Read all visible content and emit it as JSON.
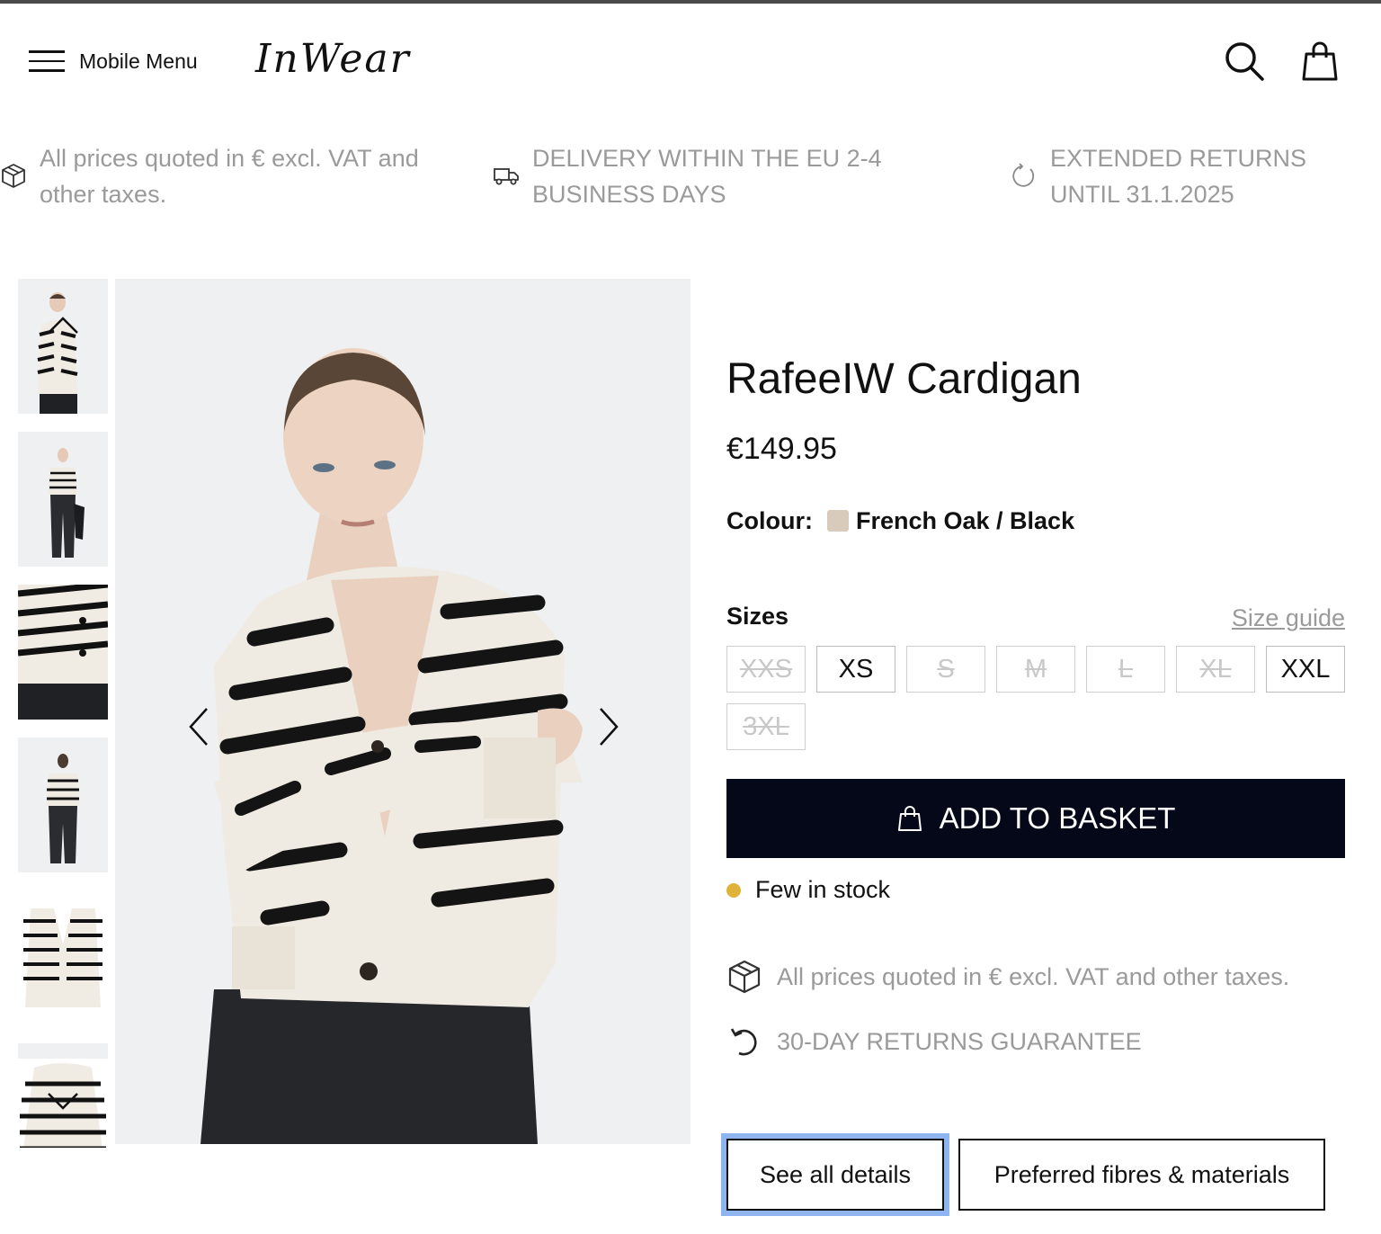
{
  "header": {
    "menu_label": "Mobile Menu",
    "logo": "InWear",
    "icons": [
      "hamburger-icon",
      "search-icon",
      "bag-icon"
    ]
  },
  "usp": [
    {
      "icon": "box-icon",
      "text": "All prices quoted in € excl. VAT and other taxes."
    },
    {
      "icon": "truck-icon",
      "text": "DELIVERY WITHIN THE EU 2-4 BUSINESS DAYS"
    },
    {
      "icon": "refresh-icon",
      "text": "EXTENDED RETURNS UNTIL 31.1.2025"
    }
  ],
  "product": {
    "title": "RafeeIW Cardigan",
    "price": "€149.95",
    "colour_label": "Colour:",
    "colour_name": "French Oak / Black",
    "colour_hex": "#d8cbbb",
    "sizes_label": "Sizes",
    "size_guide": "Size guide",
    "sizes": [
      {
        "label": "XXS",
        "available": false
      },
      {
        "label": "XS",
        "available": true
      },
      {
        "label": "S",
        "available": false
      },
      {
        "label": "M",
        "available": false
      },
      {
        "label": "L",
        "available": false
      },
      {
        "label": "XL",
        "available": false
      },
      {
        "label": "XXL",
        "available": true
      },
      {
        "label": "3XL",
        "available": false
      }
    ],
    "add_to_basket": "ADD TO BASKET",
    "stock": "Few in stock",
    "stock_color": "#e0b23a",
    "info": [
      {
        "icon": "box-icon",
        "text": "All prices quoted in € excl. VAT and other taxes."
      },
      {
        "icon": "return-icon",
        "text": "30-DAY RETURNS GUARANTEE"
      }
    ],
    "tabs": [
      "See all details",
      "Preferred fibres & materials"
    ]
  },
  "colors": {
    "button_bg": "#050818",
    "muted_text": "#9a9a9a",
    "focus_ring": "#8fb5f0"
  }
}
